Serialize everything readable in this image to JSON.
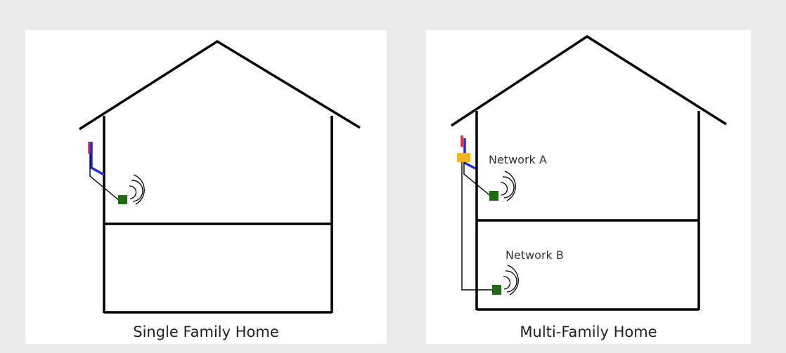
{
  "panels": {
    "single": {
      "caption": "Single Family Home"
    },
    "multi": {
      "caption": "Multi-Family Home",
      "network_a": "Network A",
      "network_b": "Network B"
    }
  },
  "colors": {
    "background": "#ebebeb",
    "panel": "#ffffff",
    "house_outline": "#000000",
    "cable_red": "#e8203a",
    "cable_blue": "#1f2bdc",
    "router_green": "#1e6b14",
    "splitter_orange": "#f5b623",
    "wire": "#000000"
  },
  "icons": [
    "wifi-signal-icon",
    "router-icon",
    "splitter-icon"
  ]
}
